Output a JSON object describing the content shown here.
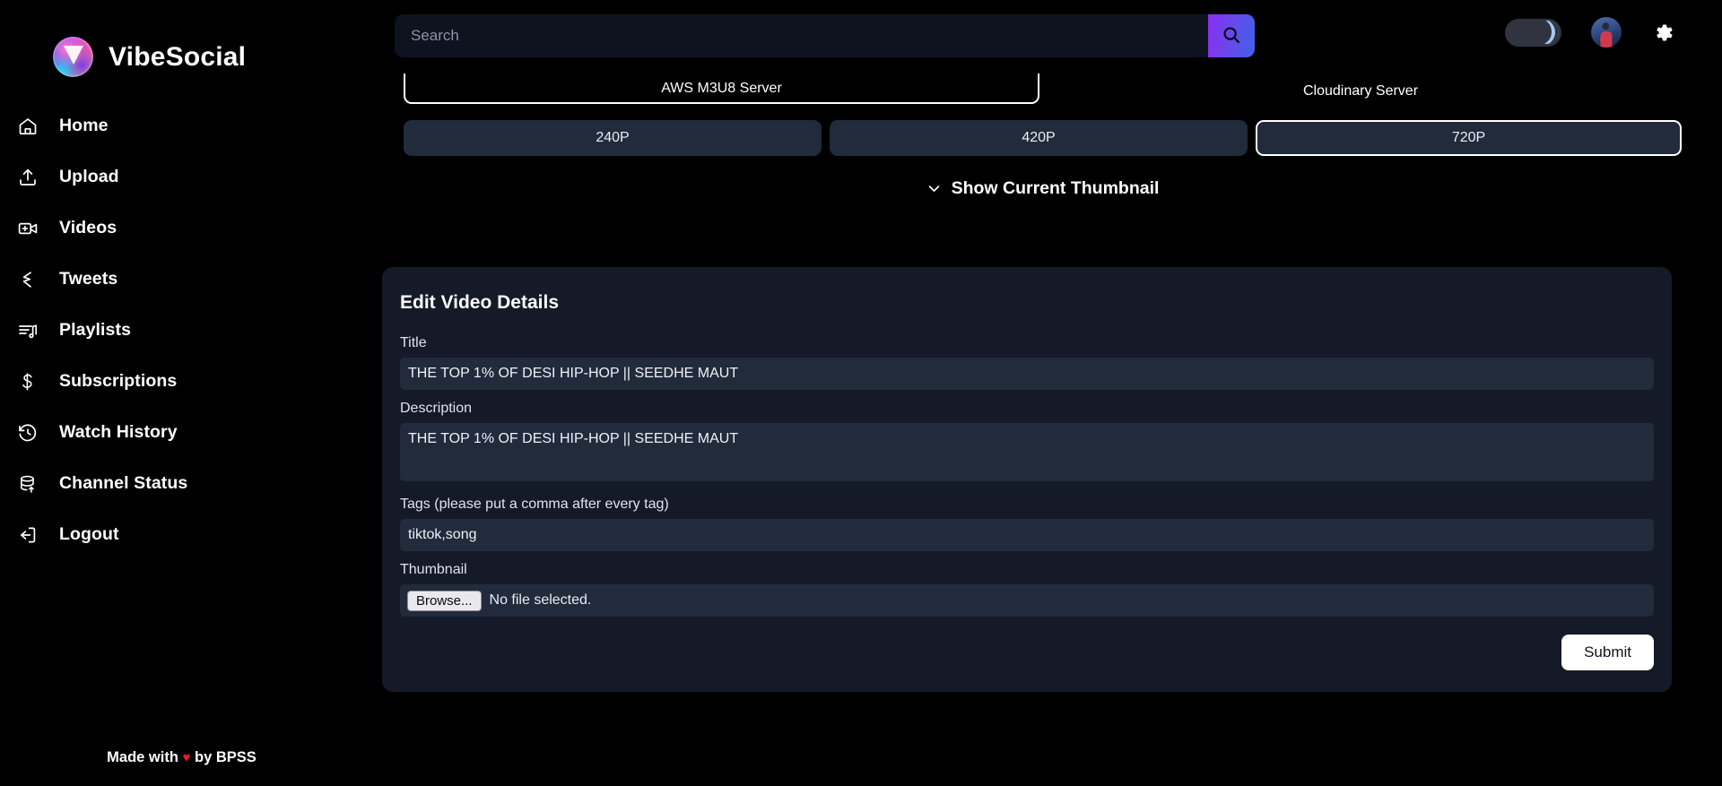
{
  "brand": {
    "name": "VibeSocial",
    "logo_icon": "vibesocial-logo-icon"
  },
  "sidebar": {
    "items": [
      {
        "label": "Home",
        "icon": "home-icon"
      },
      {
        "label": "Upload",
        "icon": "upload-icon"
      },
      {
        "label": "Videos",
        "icon": "video-camera-icon"
      },
      {
        "label": "Tweets",
        "icon": "tweet-chevron-icon"
      },
      {
        "label": "Playlists",
        "icon": "playlist-music-icon"
      },
      {
        "label": "Subscriptions",
        "icon": "subscriptions-icon"
      },
      {
        "label": "Watch History",
        "icon": "clock-history-icon"
      },
      {
        "label": "Channel Status",
        "icon": "database-upload-icon"
      },
      {
        "label": "Logout",
        "icon": "logout-icon"
      }
    ],
    "footer": {
      "prefix": "Made with",
      "heart": "♥",
      "suffix": "by BPSS"
    }
  },
  "topbar": {
    "search": {
      "placeholder": "Search",
      "value": "",
      "button_icon": "search-icon"
    },
    "theme_toggle": {
      "icon": "moon-icon",
      "state": "dark"
    },
    "avatar": {
      "icon": "user-avatar"
    },
    "settings": {
      "icon": "gear-icon"
    }
  },
  "main": {
    "servers": [
      {
        "label": "AWS M3U8 Server",
        "selected": true
      },
      {
        "label": "Cloudinary Server",
        "selected": false
      }
    ],
    "qualities": [
      {
        "label": "240P",
        "selected": false
      },
      {
        "label": "420P",
        "selected": false
      },
      {
        "label": "720P",
        "selected": true
      }
    ],
    "thumbnail_toggle": {
      "label": "Show Current Thumbnail",
      "icon": "chevron-down-icon"
    },
    "edit_card": {
      "heading": "Edit Video Details",
      "title": {
        "label": "Title",
        "value": "THE TOP 1% OF DESI HIP-HOP || SEEDHE MAUT"
      },
      "description": {
        "label": "Description",
        "value": "THE TOP 1% OF DESI HIP-HOP || SEEDHE MAUT"
      },
      "tags": {
        "label": "Tags (please put a comma after every tag)",
        "value": "tiktok,song"
      },
      "thumbnail": {
        "label": "Thumbnail",
        "browse_label": "Browse...",
        "status": "No file selected."
      },
      "submit_label": "Submit"
    }
  },
  "colors": {
    "background": "#000000",
    "card": "#141a28",
    "input": "#222b3c",
    "accent_start": "#8b2ff0",
    "accent_end": "#3f63e8",
    "heart": "#e81b23",
    "selected_border": "#ffffff"
  }
}
